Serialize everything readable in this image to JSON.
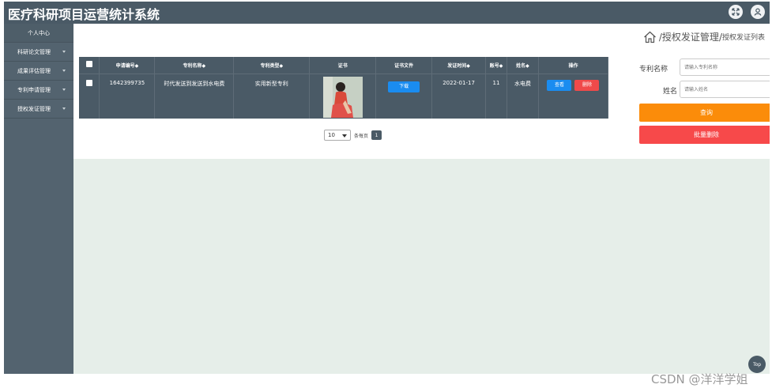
{
  "header": {
    "title": "医疗科研项目运营统计系统",
    "icons": [
      "fullscreen-icon",
      "user-icon"
    ]
  },
  "sidebar": {
    "items": [
      {
        "label": "个人中心"
      },
      {
        "label": "科研论文管理"
      },
      {
        "label": "成果评估管理"
      },
      {
        "label": "专利申请管理"
      },
      {
        "label": "授权发证管理"
      }
    ]
  },
  "breadcrumb": {
    "main": "授权发证管理",
    "sub": "授权发证列表",
    "separator": "/"
  },
  "table": {
    "headers": [
      "申请编号◆",
      "专利名称◆",
      "专利类型◆",
      "证书",
      "证书文件",
      "发证时间◆",
      "账号◆",
      "姓名◆",
      "操作"
    ],
    "rows": [
      {
        "apply_no": "1642399735",
        "patent_name": "时代发送到发送到水电费",
        "patent_type": "实用新型专利",
        "file_button": "下载",
        "issue_date": "2022-01-17",
        "account": "11",
        "name": "水电费",
        "view_button": "查看",
        "delete_button": "删除"
      }
    ]
  },
  "pagination": {
    "page_size": "10",
    "per_page_label": "条每页",
    "current_page": "1"
  },
  "search": {
    "patent_name_label": "专利名称",
    "patent_name_placeholder": "请输入专利名称",
    "name_label": "姓名",
    "name_placeholder": "请输入姓名",
    "query_button": "查询",
    "batch_delete_button": "批量删除"
  },
  "back_to_top": "Top",
  "watermark": "CSDN @洋洋学姐",
  "colors": {
    "header_bg": "#4a5a66",
    "sidebar_bg": "#53636f",
    "primary": "#1a8cf0",
    "danger": "#f04a4a",
    "warning": "#fb8c0a"
  }
}
